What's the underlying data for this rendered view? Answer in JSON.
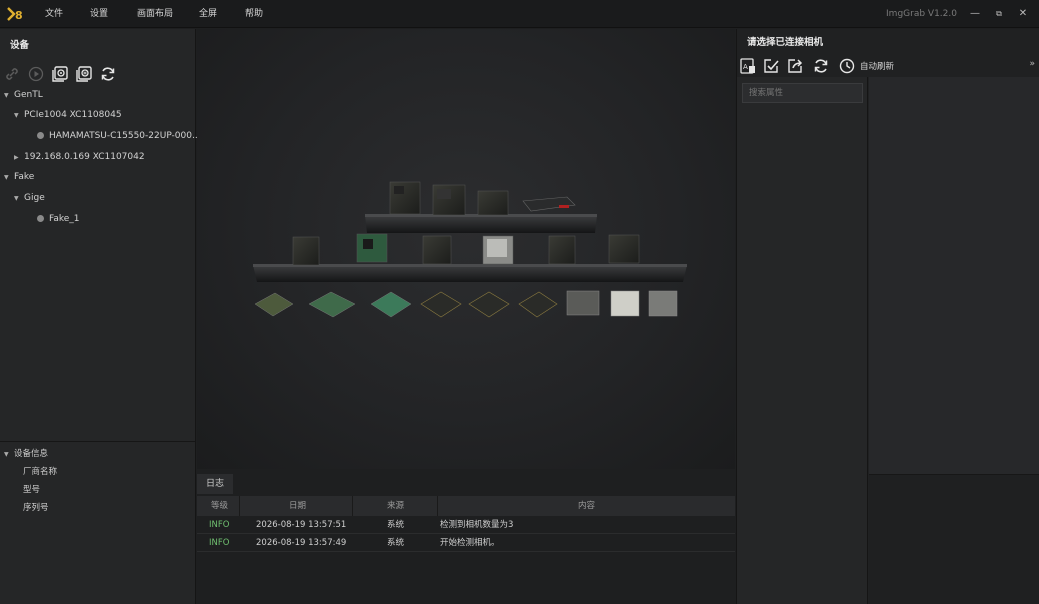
{
  "menu": [
    "文件",
    "设置",
    "画面布局",
    "全屏",
    "帮助"
  ],
  "app_version": "ImgGrab V1.2.0",
  "window_buttons": {
    "minimize": "—",
    "restore": "⧉",
    "close": "✕"
  },
  "device_panel": {
    "title": "设备",
    "tree": [
      {
        "label": "GenTL"
      },
      {
        "label": "PCIe1004 XC1108045"
      },
      {
        "label": "HAMAMATSU-C15550-22UP-000..."
      },
      {
        "label": "192.168.0.169 XC1107042"
      },
      {
        "label": "Fake"
      },
      {
        "label": "Gige"
      },
      {
        "label": "Fake_1"
      }
    ]
  },
  "device_info": {
    "title": "设备信息",
    "fields": [
      "厂商名称",
      "型号",
      "序列号"
    ]
  },
  "log": {
    "tab": "日志",
    "headers": [
      "等级",
      "日期",
      "来源",
      "内容"
    ],
    "rows": [
      {
        "level": "INFO",
        "date": "2026-08-19 13:57:51",
        "source": "系统",
        "content": "检测到相机数量为3"
      },
      {
        "level": "INFO",
        "date": "2026-08-19 13:57:49",
        "source": "系统",
        "content": "开始检测相机。"
      }
    ]
  },
  "right_panel": {
    "title": "请选择已连接相机",
    "auto_refresh": "自动刷新",
    "search_placeholder": "搜索属性",
    "expand": "»"
  },
  "colors": {
    "info_level": "#6fbf6f",
    "background": "#1e1f20",
    "panel": "#252627"
  }
}
